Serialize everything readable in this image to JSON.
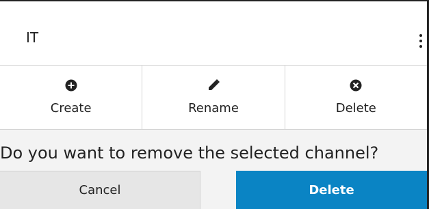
{
  "header": {
    "title": "IT",
    "menu_icon": "kebab-menu-icon"
  },
  "toolbar": {
    "items": [
      {
        "label": "Create",
        "icon": "plus-circle-icon"
      },
      {
        "label": "Rename",
        "icon": "pencil-icon"
      },
      {
        "label": "Delete",
        "icon": "x-circle-icon"
      }
    ]
  },
  "dialog": {
    "prompt": "Do you want to remove the selected channel?",
    "cancel_label": "Cancel",
    "delete_label": "Delete"
  },
  "colors": {
    "accent": "#0a84c4",
    "cancel_bg": "#e6e6e6",
    "background": "#f3f3f3"
  }
}
